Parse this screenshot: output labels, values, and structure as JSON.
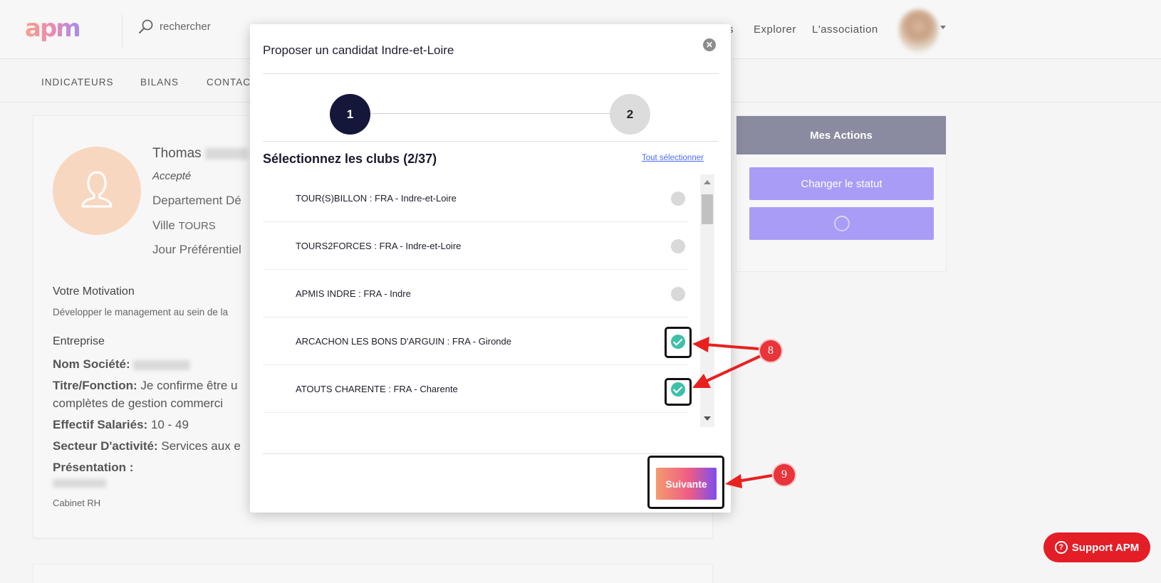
{
  "header": {
    "logo_text": "apm",
    "search_placeholder": "rechercher",
    "nav_partial": "s",
    "nav_explorer": "Explorer",
    "nav_association": "L'association"
  },
  "subnav": {
    "items": [
      "INDICATEURS",
      "BILANS",
      "CONTAC"
    ]
  },
  "profile": {
    "first_name": "Thomas",
    "status": "Accepté",
    "department_label": "Departement Dé",
    "city_label": "Ville",
    "city_value": "TOURS",
    "preferred_day_label": "Jour Préférentiel",
    "motivation_heading": "Votre Motivation",
    "motivation_text": "Développer le management au sein de la",
    "company_heading": "Entreprise",
    "company_name_label": "Nom Société:",
    "title_label": "Titre/Fonction:",
    "title_value_line1": "Je confirme être u",
    "title_value_line2": "complètes de gestion commerci",
    "employees_label": "Effectif Salariés:",
    "employees_value": "10 - 49",
    "sector_label": "Secteur D'activité:",
    "sector_value": "Services aux e",
    "presentation_label": "Présentation :",
    "presentation_footer": "Cabinet RH"
  },
  "actions": {
    "header": "Mes Actions",
    "change_status": "Changer le statut"
  },
  "support": {
    "label": "Support APM",
    "icon_glyph": "?"
  },
  "modal": {
    "title": "Proposer un candidat Indre-et-Loire",
    "close_glyph": "✕",
    "step_1": "1",
    "step_2": "2",
    "select_heading": "Sélectionnez les clubs (2/37)",
    "select_all": "Tout sélectionner",
    "clubs": [
      {
        "name": "TOUR(S)BILLON : FRA - Indre-et-Loire",
        "checked": false
      },
      {
        "name": "TOURS2FORCES : FRA - Indre-et-Loire",
        "checked": false
      },
      {
        "name": "APMIS INDRE : FRA - Indre",
        "checked": false
      },
      {
        "name": "ARCACHON LES BONS D'ARGUIN : FRA - Gironde",
        "checked": true
      },
      {
        "name": "ATOUTS CHARENTE : FRA - Charente",
        "checked": true
      }
    ],
    "next_button": "Suivante"
  },
  "annotations": {
    "badge_8": "8",
    "badge_9": "9",
    "arrow_color": "#e8201e"
  },
  "colors": {
    "brand_dark": "#14173a",
    "accent_purple": "#a99cf6",
    "check_green": "#3ec0a8",
    "support_red": "#e41e26"
  }
}
